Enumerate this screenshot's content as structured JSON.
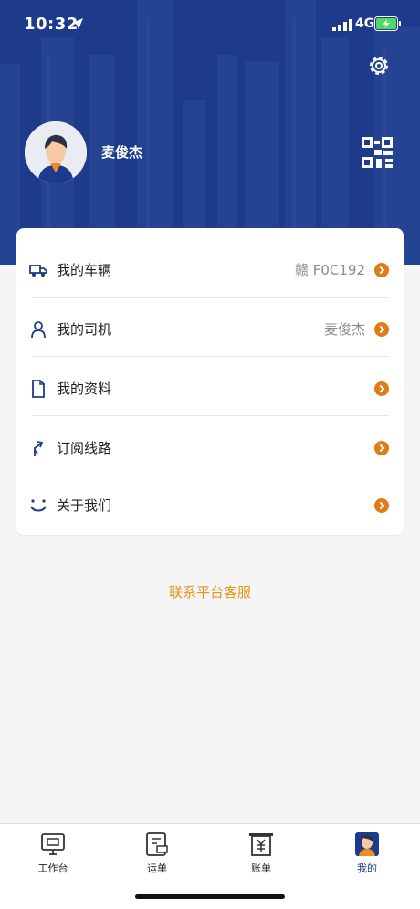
{
  "status": {
    "time": "10:32",
    "network": "4G"
  },
  "profile": {
    "name": "麦俊杰"
  },
  "menu": [
    {
      "label": "我的车辆",
      "value": "赣 F0C192",
      "icon": "truck-icon"
    },
    {
      "label": "我的司机",
      "value": "麦俊杰",
      "icon": "person-icon"
    },
    {
      "label": "我的资料",
      "value": "",
      "icon": "document-icon"
    },
    {
      "label": "订阅线路",
      "value": "",
      "icon": "route-icon"
    },
    {
      "label": "关于我们",
      "value": "",
      "icon": "smile-icon"
    }
  ],
  "contact": {
    "label": "联系平台客服"
  },
  "tabs": [
    {
      "label": "工作台",
      "icon": "workbench-icon"
    },
    {
      "label": "运单",
      "icon": "waybill-icon"
    },
    {
      "label": "账单",
      "icon": "bill-icon"
    },
    {
      "label": "我的",
      "icon": "mine-icon"
    }
  ],
  "colors": {
    "header": "#1e3a8a",
    "accent": "#e17b17",
    "contact": "#e89218",
    "active_tab": "#1e3a8a"
  }
}
